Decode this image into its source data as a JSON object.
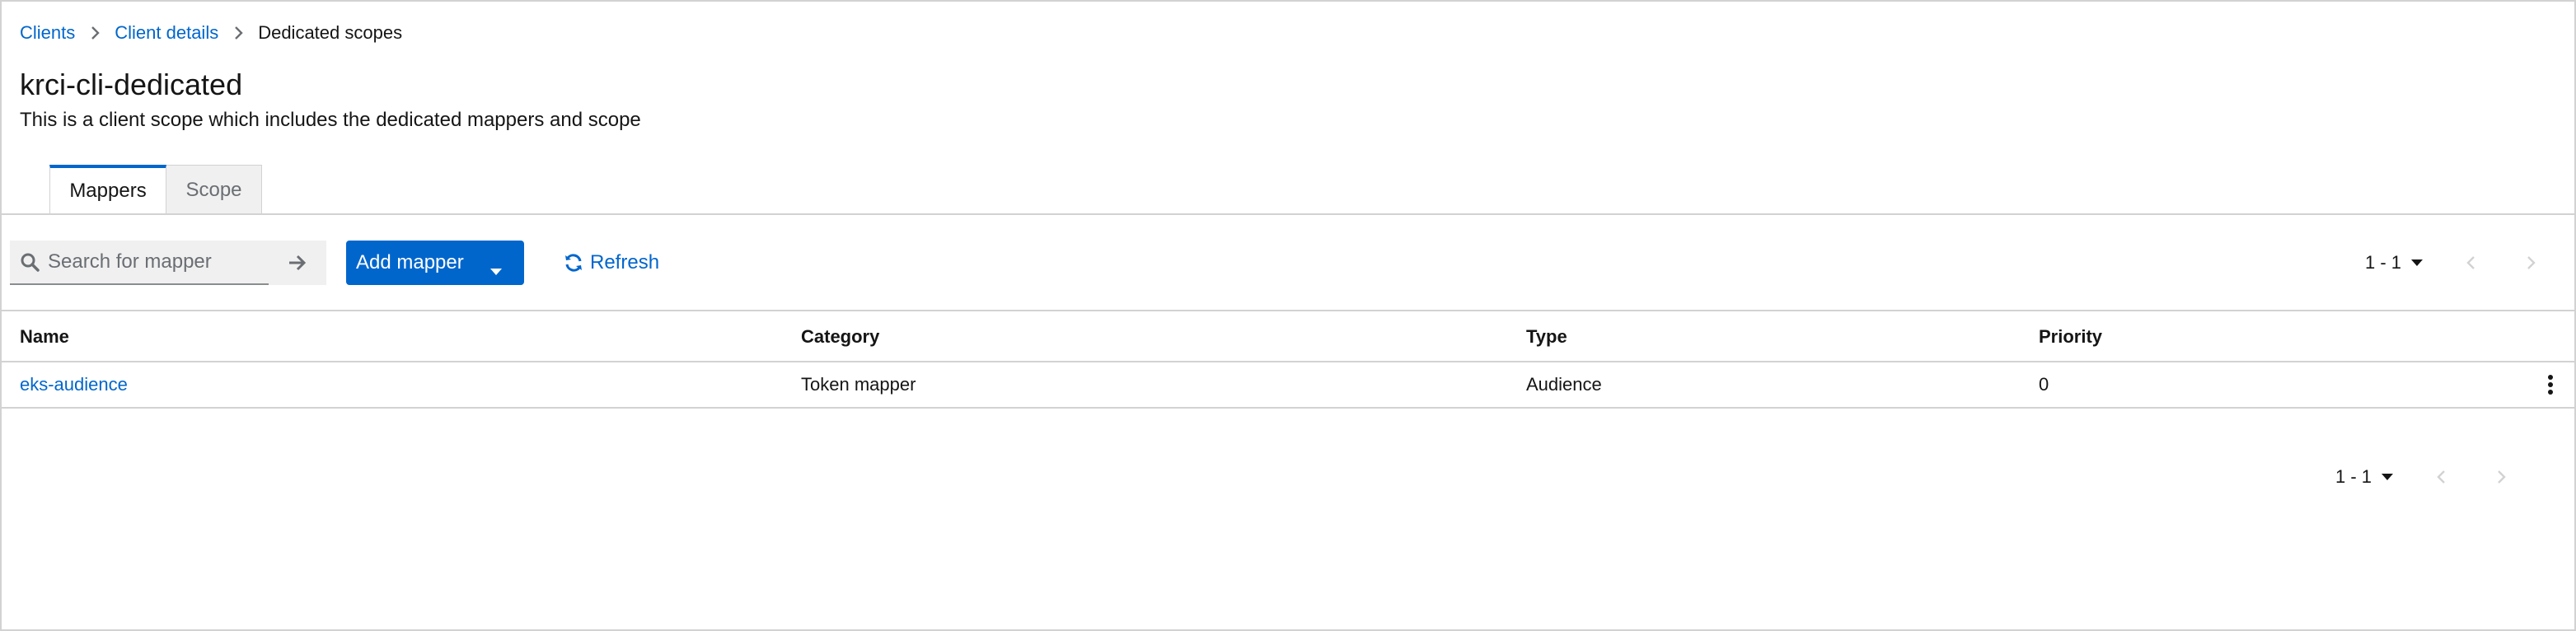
{
  "breadcrumb": {
    "items": [
      "Clients",
      "Client details"
    ],
    "current": "Dedicated scopes"
  },
  "header": {
    "title": "krci-cli-dedicated",
    "description": "This is a client scope which includes the dedicated mappers and scope"
  },
  "tabs": [
    {
      "label": "Mappers",
      "active": true
    },
    {
      "label": "Scope",
      "active": false
    }
  ],
  "toolbar": {
    "search_placeholder": "Search for mapper",
    "search_value": "",
    "add_mapper_label": "Add mapper",
    "refresh_label": "Refresh"
  },
  "pagination": {
    "top_label": "1 - 1",
    "bottom_label": "1 - 1"
  },
  "table": {
    "columns": [
      "Name",
      "Category",
      "Type",
      "Priority"
    ],
    "rows": [
      {
        "name": "eks-audience",
        "category": "Token mapper",
        "type": "Audience",
        "priority": "0"
      }
    ]
  },
  "icons": {
    "breadcrumb_separator": "chevron-right-icon",
    "search": "search-icon",
    "search_submit": "arrow-right-icon",
    "dropdown": "caret-down-icon",
    "refresh": "sync-icon",
    "prev": "angle-left-icon",
    "next": "angle-right-icon",
    "row_actions": "kebab-icon"
  },
  "colors": {
    "link": "#0066cc",
    "primary_button": "#0066cc",
    "text": "#151515",
    "muted": "#6a6e73",
    "disabled": "#d2d2d2",
    "border": "#d2d2d2"
  }
}
